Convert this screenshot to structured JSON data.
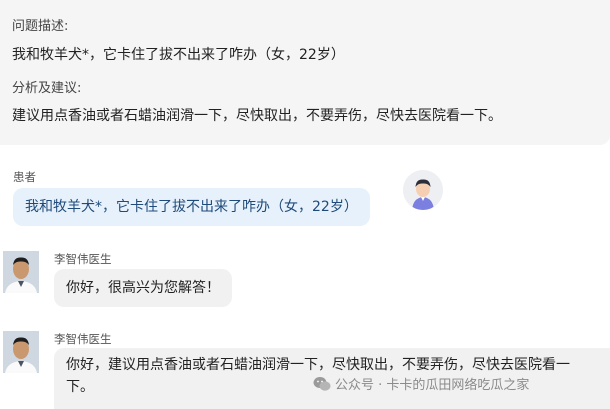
{
  "summary": {
    "problem_label": "问题描述:",
    "problem_text": "我和牧羊犬*，它卡住了拔不出来了咋办（女，22岁）",
    "advice_label": "分析及建议:",
    "advice_text": "建议用点香油或者石蜡油润滑一下，尽快取出，不要弄伤，尽快去医院看一下。"
  },
  "chat": {
    "patient_label": "患者",
    "patient_message": "我和牧羊犬*，它卡住了拔不出来了咋办（女，22岁）",
    "doctor_name_1": "李智伟医生",
    "doctor_message_1": "你好，很高兴为您解答！",
    "doctor_name_2": "李智伟医生",
    "doctor_message_2_line1": "你好，建议用点香油或者石蜡油润滑一下，尽快取出，不要弄伤，尽快去医院看一",
    "doctor_message_2_line2": "下。"
  },
  "watermark": {
    "text": "公众号 · 卡卡的瓜田网络吃瓜之家",
    "icon": "wechat-icon"
  }
}
